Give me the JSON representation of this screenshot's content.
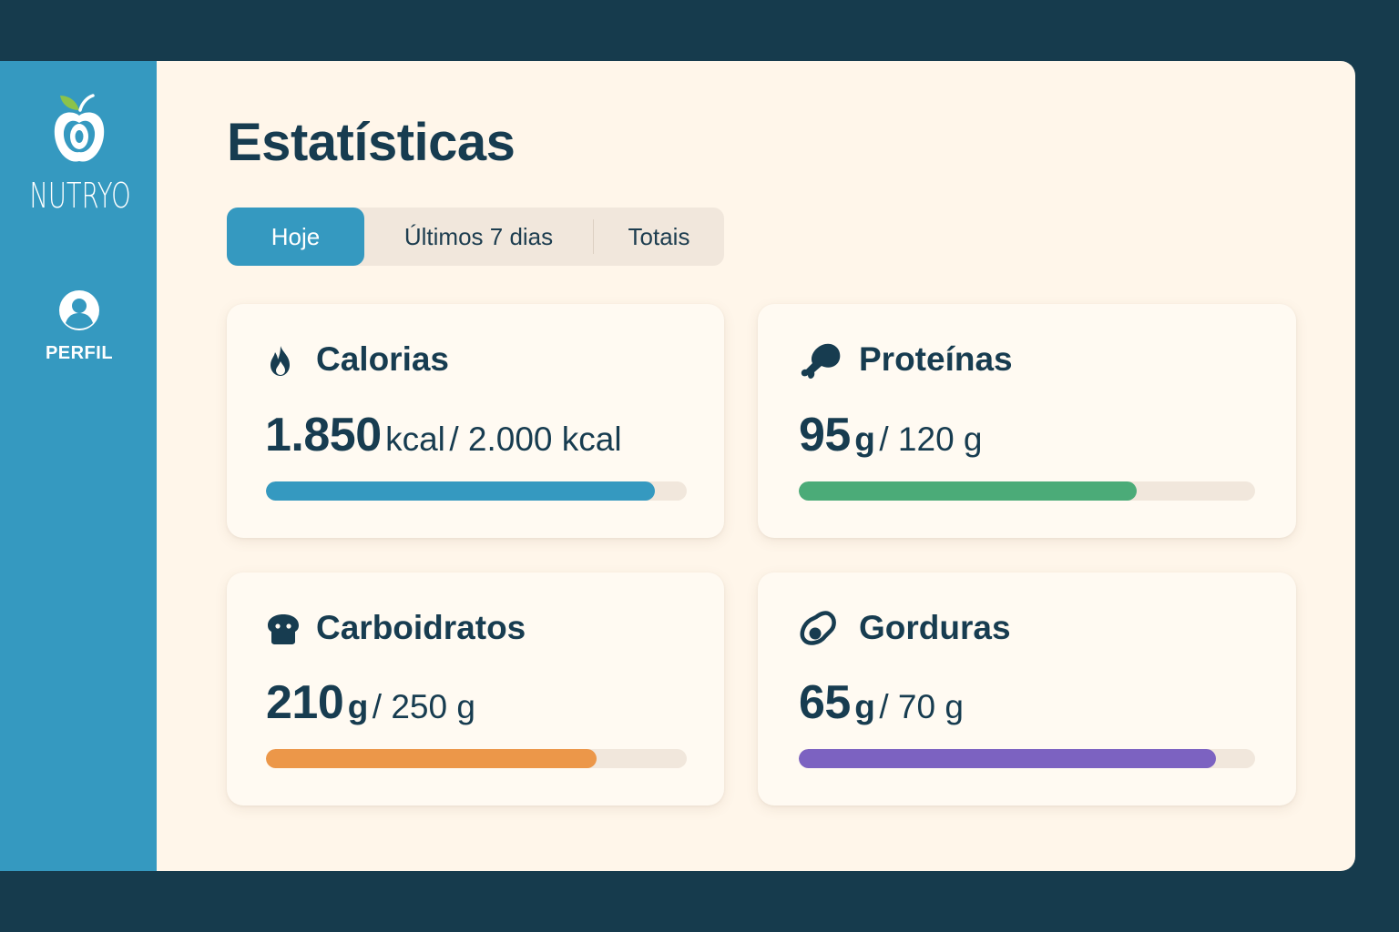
{
  "app": {
    "name": "NUTRYO",
    "logo_icon": "apple-logo-icon"
  },
  "sidebar": {
    "items": [
      {
        "label": "PERFIL",
        "icon": "user-profile-icon"
      }
    ]
  },
  "page": {
    "title": "Estatísticas"
  },
  "tabs": [
    {
      "label": "Hoje",
      "active": true
    },
    {
      "label": "Últimos 7 dias",
      "active": false
    },
    {
      "label": "Totais",
      "active": false
    }
  ],
  "colors": {
    "sidebar": "#3599c0",
    "active_tab": "#3599c0",
    "calorias": "#3599c0",
    "proteinas": "#4bab78",
    "carboidratos": "#ec9749",
    "gorduras": "#7c62c1",
    "track": "#f1e7dc",
    "text": "#173c50"
  },
  "cards": {
    "calorias": {
      "title": "Calorias",
      "icon": "flame-icon",
      "value": "1.850",
      "unit": "kcal",
      "goal": "/ 2.000 kcal",
      "progress": 0.925
    },
    "proteinas": {
      "title": "Proteínas",
      "icon": "drumstick-icon",
      "value": "95",
      "unit": "g",
      "goal": "/ 120 g",
      "progress": 0.74
    },
    "carboidratos": {
      "title": "Carboidratos",
      "icon": "bread-icon",
      "value": "210",
      "unit": "g",
      "goal": "/ 250 g",
      "progress": 0.786
    },
    "gorduras": {
      "title": "Gorduras",
      "icon": "avocado-icon",
      "value": "65",
      "unit": "g",
      "goal": "/ 70 g",
      "progress": 0.914
    }
  }
}
